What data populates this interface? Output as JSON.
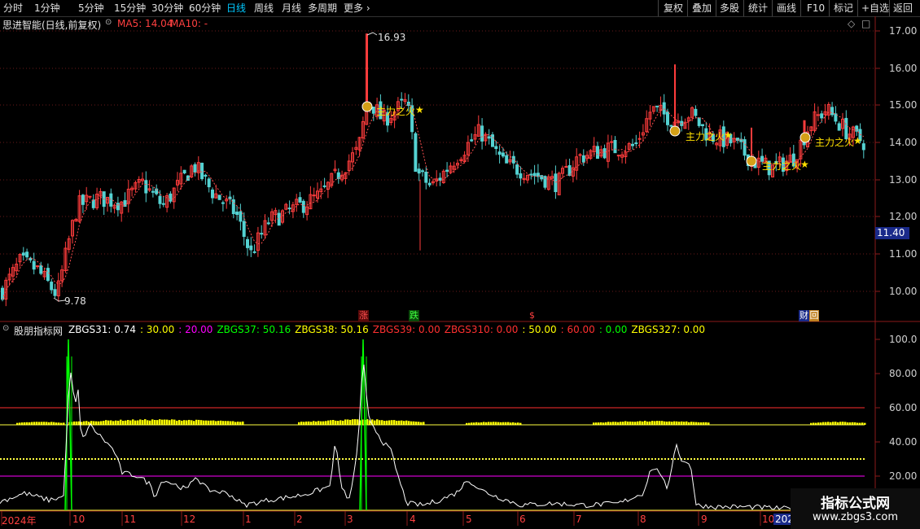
{
  "toolbar": {
    "periods": [
      "分时",
      "1分钟",
      "5分钟",
      "15分钟",
      "30分钟",
      "60分钟",
      "日线",
      "周线",
      "月线",
      "多周期",
      "更多"
    ],
    "active_period": "日线",
    "right_buttons": [
      "复权",
      "叠加",
      "多股",
      "统计",
      "画线",
      "F10",
      "标记",
      "+自选",
      "返回"
    ]
  },
  "main_header": {
    "stock_name": "思进智能(日线,前复权)",
    "ma5": "MA5: 14.04",
    "ma10": "MA10: -"
  },
  "price_axis": {
    "ticks": [
      "17.00",
      "16.00",
      "15.00",
      "14.00",
      "13.00",
      "12.00",
      "11.00",
      "10.00"
    ],
    "current_price": "11.40"
  },
  "price_annotations": {
    "high": "16.93",
    "low": "9.78",
    "signal_label": "主力之火",
    "signal_star": "★"
  },
  "event_markers": {
    "rise": "涨",
    "fall": "跌",
    "dollar": "$",
    "finance": "财",
    "finance_box": "回"
  },
  "indicator_header": {
    "name": "股朋指标网",
    "items": [
      {
        "text": "ZBGS31: 0.74",
        "color": "#ffffff"
      },
      {
        "text": ": 30.00",
        "color": "#ffff00"
      },
      {
        "text": ": 20.00",
        "color": "#ff00ff"
      },
      {
        "text": "ZBGS37: 50.16",
        "color": "#00ff00"
      },
      {
        "text": "ZBGS38: 50.16",
        "color": "#ffff00"
      },
      {
        "text": "ZBGS39: 0.00",
        "color": "#ff3030"
      },
      {
        "text": "ZBGS310: 0.00",
        "color": "#ff3030"
      },
      {
        "text": ": 50.00",
        "color": "#ffff00"
      },
      {
        "text": ": 60.00",
        "color": "#ff3030"
      },
      {
        "text": ": 0.00",
        "color": "#00ff00"
      },
      {
        "text": "ZBGS327: 0.00",
        "color": "#ffff00"
      }
    ]
  },
  "indicator_axis": {
    "ticks": [
      "100.0",
      "80.00",
      "60.00",
      "40.00",
      "20.00"
    ]
  },
  "date_axis": {
    "labels": [
      "2024年",
      "10",
      "11",
      "12",
      "1",
      "2",
      "3",
      "4",
      "5",
      "6",
      "7",
      "8",
      "9",
      "10",
      "202"
    ]
  },
  "watermark": {
    "title": "指标公式网",
    "url": "www.zbgs3.com"
  },
  "colors": {
    "up": "#ff3c3c",
    "down": "#54d2d2",
    "ma": "#ff5050",
    "accent": "#00c8ff"
  }
}
